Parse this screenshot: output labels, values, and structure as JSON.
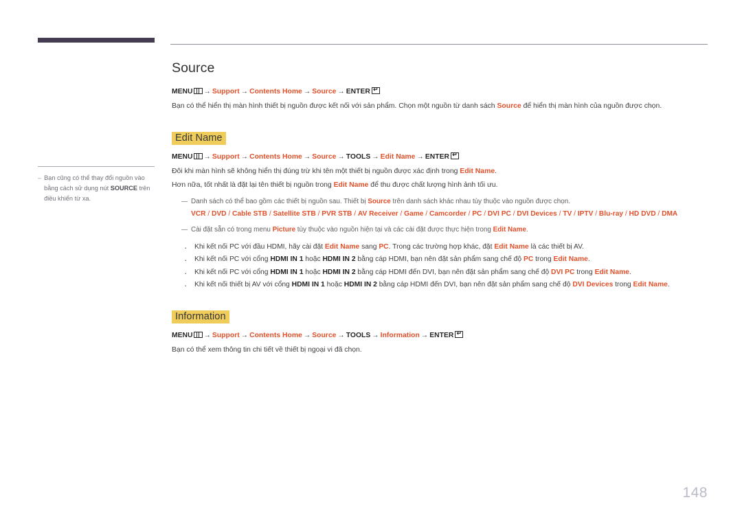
{
  "page": {
    "number": "148",
    "chapter_bar_color": "#453c52",
    "accent_color": "#e0502a",
    "highlight_color": "#f0cd5a",
    "page_number_color": "#b9bcc9"
  },
  "side_note": {
    "dash": "–",
    "text_before": "Bạn cũng có thể thay đổi nguồn vào bằng cách sử dụng nút ",
    "bold": "SOURCE",
    "text_after": " trên điều khiển từ xa."
  },
  "sections": [
    {
      "id": "source",
      "title": "Source",
      "title_style": "plain",
      "path": {
        "menu_label": "MENU",
        "menu_icon": "menu-grid-icon",
        "items": [
          "Support",
          "Contents Home",
          "Source"
        ],
        "tools": null,
        "enter_label": "ENTER",
        "enter_icon": "enter-return-icon"
      },
      "body": {
        "part1": "Bạn có thể hiển thị màn hình thiết bị nguồn được kết nối với sản phẩm. Chọn một nguồn từ danh sách ",
        "accent": "Source",
        "part2": " để hiển thị màn hình của nguồn được chọn."
      }
    },
    {
      "id": "edit-name",
      "title": "Edit Name",
      "title_style": "highlight",
      "path": {
        "menu_label": "MENU",
        "menu_icon": "menu-grid-icon",
        "items": [
          "Support",
          "Contents Home",
          "Source"
        ],
        "tools": "TOOLS",
        "tools_item": "Edit Name",
        "enter_label": "ENTER",
        "enter_icon": "enter-return-icon"
      },
      "paragraphs": [
        {
          "part1": "Đôi khi màn hình sẽ không hiển thị đúng trừ khi tên một thiết bị nguồn được xác định trong ",
          "accent": "Edit Name",
          "part2": "."
        },
        {
          "part1": "Hơn nữa, tốt nhất là đặt lại tên thiết bị nguồn trong ",
          "accent": "Edit Name",
          "part2": " để thu được chất lượng hình ảnh tối ưu."
        }
      ],
      "notes": [
        {
          "part1": "Danh sách có thể bao gồm các thiết bị nguồn sau. Thiết bị ",
          "accent": "Source",
          "part2": " trên danh sách khác nhau tùy thuộc vào nguồn được chọn.",
          "device_list": [
            "VCR",
            "DVD",
            "Cable STB",
            "Satellite STB",
            "PVR STB",
            "AV Receiver",
            "Game",
            "Camcorder",
            "PC",
            "DVI PC",
            "DVI Devices",
            "TV",
            "IPTV",
            "Blu-ray",
            "HD DVD",
            "DMA"
          ]
        },
        {
          "part1": "Cài đặt sẵn có trong menu ",
          "accent": "Picture",
          "part2": " tùy thuộc vào nguồn hiện tại và các cài đặt được thực hiện trong ",
          "accent2": "Edit Name",
          "part3": "."
        }
      ],
      "bullets": [
        [
          {
            "t": "Khi kết nối PC với đầu HDMI, hãy cài đặt ",
            "s": "n"
          },
          {
            "t": "Edit Name",
            "s": "a"
          },
          {
            "t": " sang ",
            "s": "n"
          },
          {
            "t": "PC",
            "s": "a"
          },
          {
            "t": ". Trong các trường hợp khác, đặt ",
            "s": "n"
          },
          {
            "t": "Edit Name",
            "s": "a"
          },
          {
            "t": " là các thiết bị AV.",
            "s": "n"
          }
        ],
        [
          {
            "t": "Khi kết nối PC với cổng ",
            "s": "n"
          },
          {
            "t": "HDMI IN 1",
            "s": "b"
          },
          {
            "t": " hoặc ",
            "s": "n"
          },
          {
            "t": "HDMI IN 2",
            "s": "b"
          },
          {
            "t": " bằng cáp HDMI, bạn nên đặt sản phẩm sang chế độ ",
            "s": "n"
          },
          {
            "t": "PC",
            "s": "a"
          },
          {
            "t": " trong ",
            "s": "n"
          },
          {
            "t": "Edit Name",
            "s": "a"
          },
          {
            "t": ".",
            "s": "n"
          }
        ],
        [
          {
            "t": "Khi kết nối PC với cổng ",
            "s": "n"
          },
          {
            "t": "HDMI IN 1",
            "s": "b"
          },
          {
            "t": " hoặc ",
            "s": "n"
          },
          {
            "t": "HDMI IN 2",
            "s": "b"
          },
          {
            "t": " bằng cáp HDMI đến DVI, bạn nên đặt sản phẩm sang chế độ ",
            "s": "n"
          },
          {
            "t": "DVI PC",
            "s": "a"
          },
          {
            "t": " trong ",
            "s": "n"
          },
          {
            "t": "Edit Name",
            "s": "a"
          },
          {
            "t": ".",
            "s": "n"
          }
        ],
        [
          {
            "t": "Khi kết nối thiết bị AV với cổng ",
            "s": "n"
          },
          {
            "t": "HDMI IN 1",
            "s": "b"
          },
          {
            "t": " hoặc ",
            "s": "n"
          },
          {
            "t": "HDMI IN 2",
            "s": "b"
          },
          {
            "t": " bằng cáp HDMI đến DVI, bạn nên đặt sản phẩm sang chế độ ",
            "s": "n"
          },
          {
            "t": "DVI Devices",
            "s": "a"
          },
          {
            "t": " trong ",
            "s": "n"
          },
          {
            "t": "Edit Name",
            "s": "a"
          },
          {
            "t": ".",
            "s": "n"
          }
        ]
      ]
    },
    {
      "id": "information",
      "title": "Information",
      "title_style": "highlight",
      "path": {
        "menu_label": "MENU",
        "menu_icon": "menu-grid-icon",
        "items": [
          "Support",
          "Contents Home",
          "Source"
        ],
        "tools": "TOOLS",
        "tools_item": "Information",
        "enter_label": "ENTER",
        "enter_icon": "enter-return-icon"
      },
      "body": {
        "part1": "Bạn có thể xem thông tin chi tiết về thiết bị ngoại vi đã chọn.",
        "accent": "",
        "part2": ""
      }
    }
  ]
}
